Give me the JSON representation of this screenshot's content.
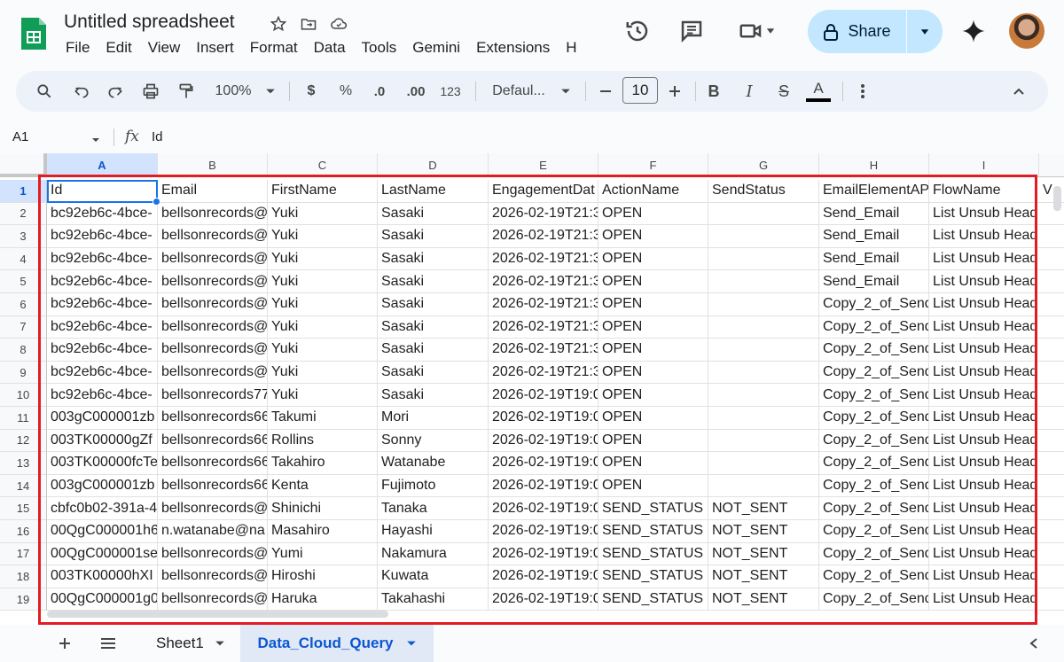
{
  "app": {
    "title": "Untitled spreadsheet",
    "menu": [
      "File",
      "Edit",
      "View",
      "Insert",
      "Format",
      "Data",
      "Tools",
      "Gemini",
      "Extensions",
      "H"
    ],
    "share_label": "Share",
    "accent": "#0b57d0",
    "share_bg": "#c2e7ff"
  },
  "toolbar": {
    "zoom": "100%",
    "currency": "$",
    "percent": "%",
    "dec_decrease": ".0",
    "dec_increase": ".00",
    "number_format": "123",
    "font": "Defaul...",
    "font_size": "10",
    "bold": "B",
    "italic": "I",
    "strike": "S",
    "text_color": "A"
  },
  "formula": {
    "cell_ref": "A1",
    "fx": "fx",
    "value": "Id"
  },
  "grid": {
    "columns": [
      "A",
      "B",
      "C",
      "D",
      "E",
      "F",
      "G",
      "H",
      "I"
    ],
    "headers": [
      "Id",
      "Email",
      "FirstName",
      "LastName",
      "EngagementDat",
      "ActionName",
      "SendStatus",
      "EmailElementAP",
      "FlowName"
    ],
    "overflow_header": "V",
    "rows": [
      [
        "bc92eb6c-4bce-",
        "bellsonrecords@",
        "Yuki",
        "Sasaki",
        "2026-02-19T21:3",
        "OPEN",
        "",
        "Send_Email",
        "List Unsub Head"
      ],
      [
        "bc92eb6c-4bce-",
        "bellsonrecords@",
        "Yuki",
        "Sasaki",
        "2026-02-19T21:3",
        "OPEN",
        "",
        "Send_Email",
        "List Unsub Head"
      ],
      [
        "bc92eb6c-4bce-",
        "bellsonrecords@",
        "Yuki",
        "Sasaki",
        "2026-02-19T21:3",
        "OPEN",
        "",
        "Send_Email",
        "List Unsub Head"
      ],
      [
        "bc92eb6c-4bce-",
        "bellsonrecords@",
        "Yuki",
        "Sasaki",
        "2026-02-19T21:3",
        "OPEN",
        "",
        "Send_Email",
        "List Unsub Head"
      ],
      [
        "bc92eb6c-4bce-",
        "bellsonrecords@",
        "Yuki",
        "Sasaki",
        "2026-02-19T21:3",
        "OPEN",
        "",
        "Copy_2_of_Send",
        "List Unsub Head"
      ],
      [
        "bc92eb6c-4bce-",
        "bellsonrecords@",
        "Yuki",
        "Sasaki",
        "2026-02-19T21:3",
        "OPEN",
        "",
        "Copy_2_of_Send",
        "List Unsub Head"
      ],
      [
        "bc92eb6c-4bce-",
        "bellsonrecords@",
        "Yuki",
        "Sasaki",
        "2026-02-19T21:3",
        "OPEN",
        "",
        "Copy_2_of_Send",
        "List Unsub Head"
      ],
      [
        "bc92eb6c-4bce-",
        "bellsonrecords@",
        "Yuki",
        "Sasaki",
        "2026-02-19T21:3",
        "OPEN",
        "",
        "Copy_2_of_Send",
        "List Unsub Head"
      ],
      [
        "bc92eb6c-4bce-",
        "bellsonrecords77",
        "Yuki",
        "Sasaki",
        "2026-02-19T19:0",
        "OPEN",
        "",
        "Copy_2_of_Send",
        "List Unsub Head"
      ],
      [
        "003gC000001zb",
        "bellsonrecords66",
        "Takumi",
        "Mori",
        "2026-02-19T19:0",
        "OPEN",
        "",
        "Copy_2_of_Send",
        "List Unsub Head"
      ],
      [
        "003TK00000gZf",
        "bellsonrecords66",
        "Rollins",
        "Sonny",
        "2026-02-19T19:0",
        "OPEN",
        "",
        "Copy_2_of_Send",
        "List Unsub Head"
      ],
      [
        "003TK00000fcTe",
        "bellsonrecords66",
        "Takahiro",
        "Watanabe",
        "2026-02-19T19:0",
        "OPEN",
        "",
        "Copy_2_of_Send",
        "List Unsub Head"
      ],
      [
        "003gC000001zb",
        "bellsonrecords66",
        "Kenta",
        "Fujimoto",
        "2026-02-19T19:0",
        "OPEN",
        "",
        "Copy_2_of_Send",
        "List Unsub Head"
      ],
      [
        "cbfc0b02-391a-4",
        "bellsonrecords@",
        "Shinichi",
        "Tanaka",
        "2026-02-19T19:0",
        "SEND_STATUS",
        "NOT_SENT",
        "Copy_2_of_Send",
        "List Unsub Head"
      ],
      [
        "00QgC000001h6",
        "n.watanabe@na",
        "Masahiro",
        "Hayashi",
        "2026-02-19T19:0",
        "SEND_STATUS",
        "NOT_SENT",
        "Copy_2_of_Send",
        "List Unsub Head"
      ],
      [
        "00QgC000001se",
        "bellsonrecords@",
        "Yumi",
        "Nakamura",
        "2026-02-19T19:0",
        "SEND_STATUS",
        "NOT_SENT",
        "Copy_2_of_Send",
        "List Unsub Head"
      ],
      [
        "003TK00000hXI",
        "bellsonrecords@",
        "Hiroshi",
        "Kuwata",
        "2026-02-19T19:0",
        "SEND_STATUS",
        "NOT_SENT",
        "Copy_2_of_Send",
        "List Unsub Head"
      ],
      [
        "00QgC000001g0",
        "bellsonrecords@",
        "Haruka",
        "Takahashi",
        "2026-02-19T19:0",
        "SEND_STATUS",
        "NOT_SENT",
        "Copy_2_of_Send",
        "List Unsub Head"
      ]
    ]
  },
  "sheets": {
    "tabs": [
      "Sheet1",
      "Data_Cloud_Query"
    ],
    "active_index": 1
  }
}
